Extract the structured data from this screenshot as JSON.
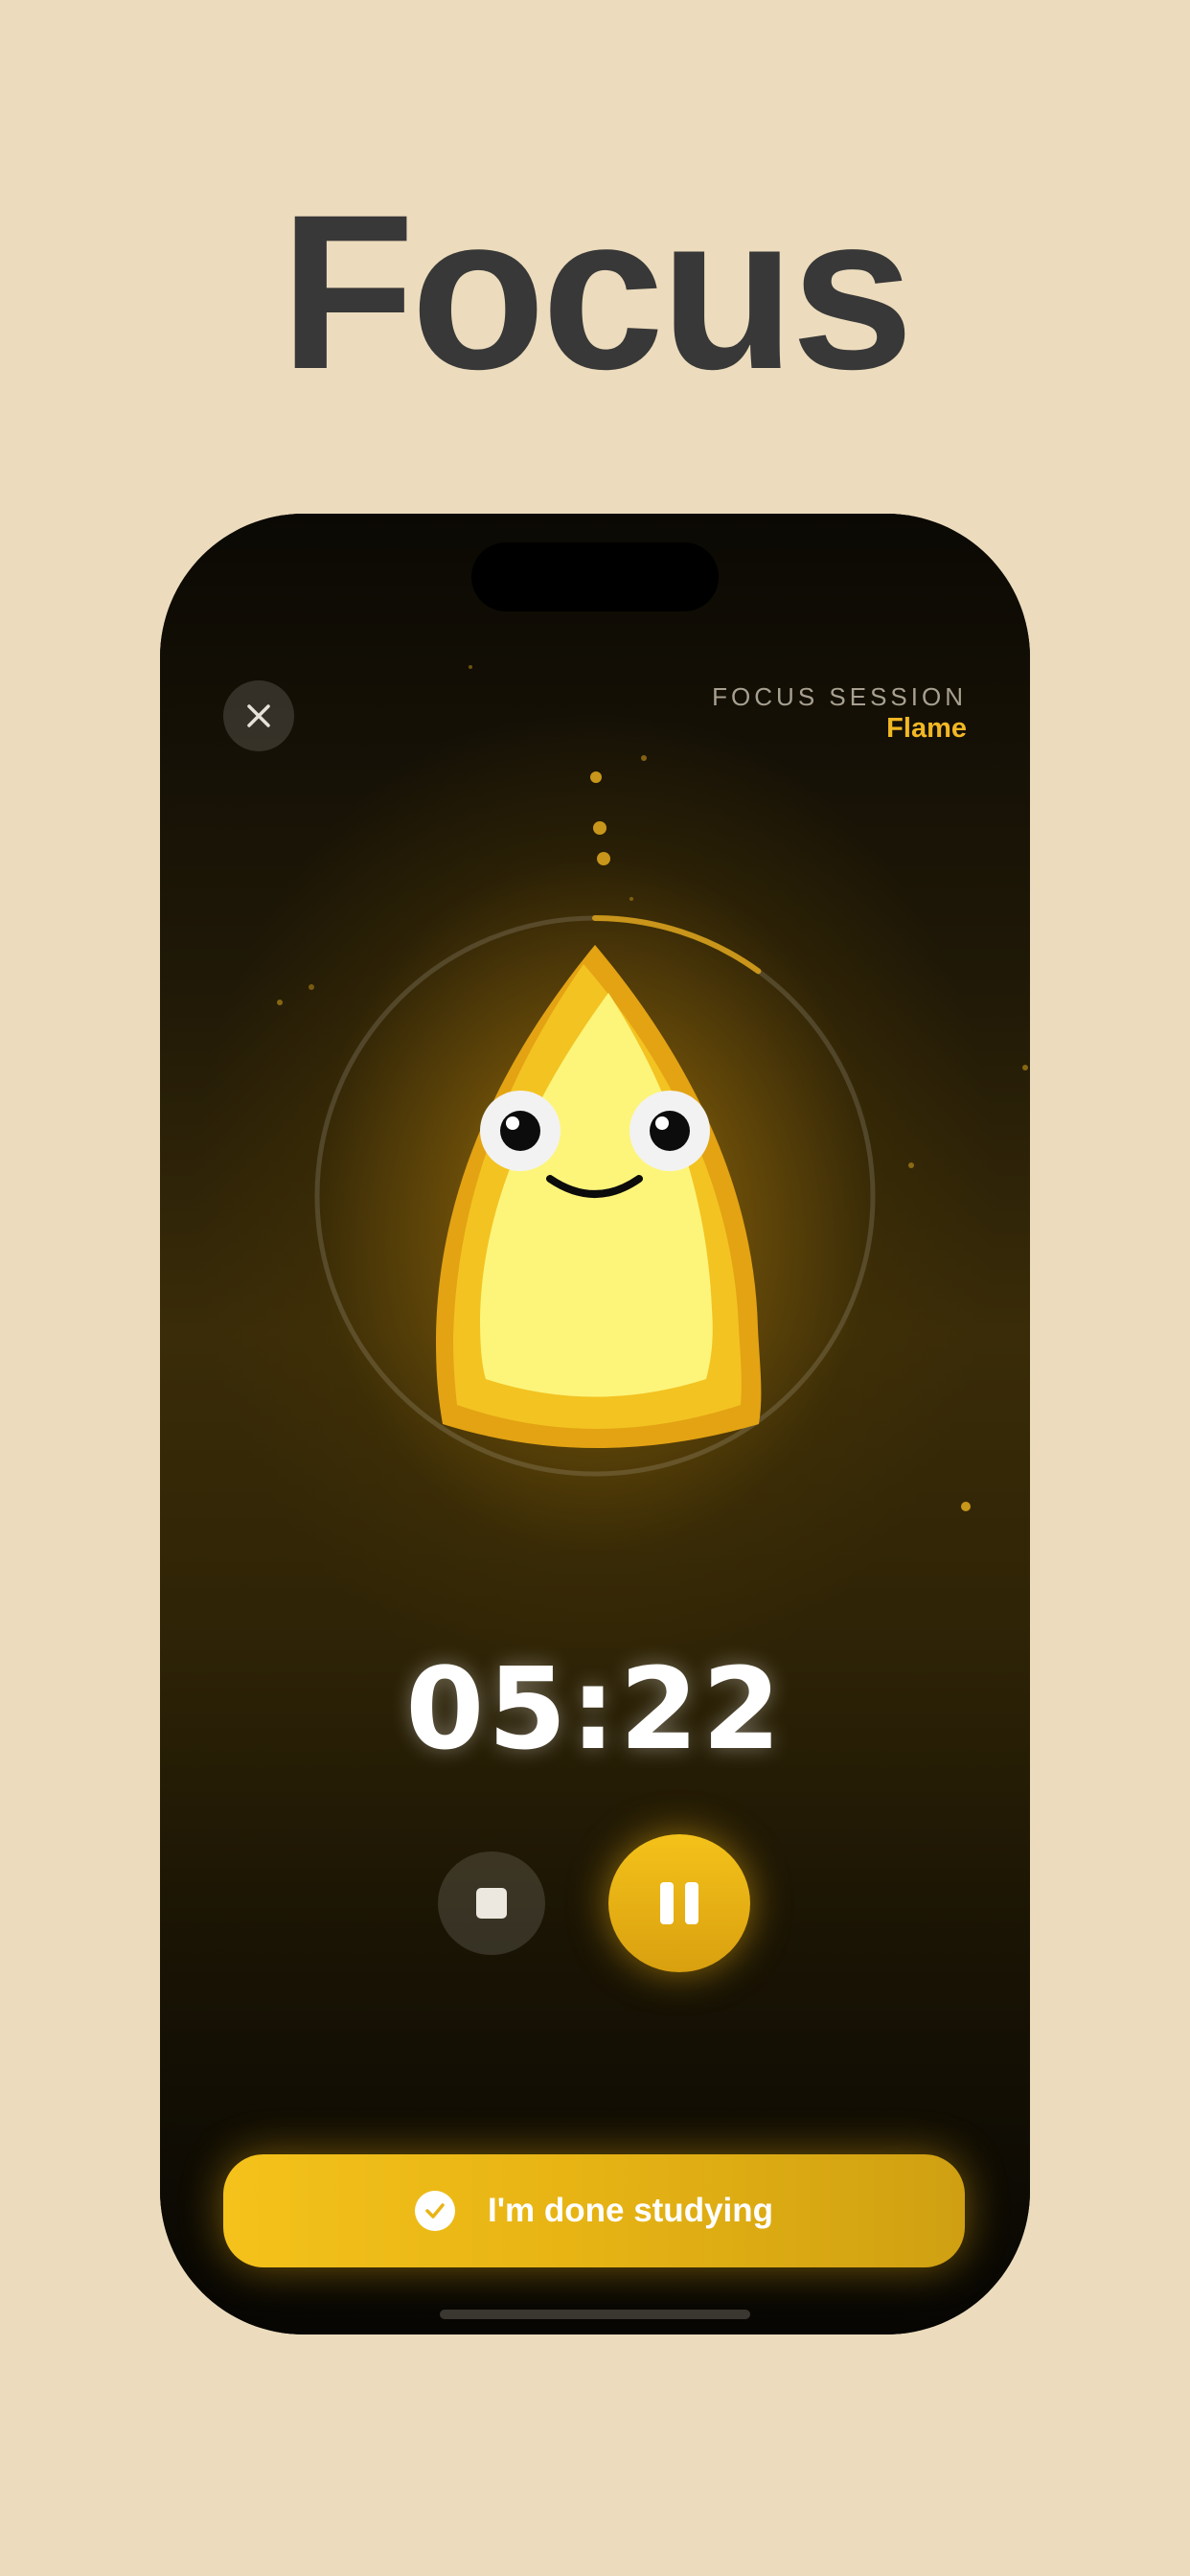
{
  "headline": "Focus",
  "session": {
    "label": "FOCUS SESSION",
    "name": "Flame"
  },
  "timer": {
    "display": "05:22",
    "progress_fraction": 0.1
  },
  "controls": {
    "close_icon": "close-icon",
    "stop_icon": "stop-icon",
    "pause_icon": "pause-icon"
  },
  "done_button": {
    "label": "I'm done studying",
    "icon": "checkmark-icon"
  },
  "colors": {
    "background": "#ecdcbd",
    "accent": "#f2b824",
    "headline": "#383838"
  }
}
